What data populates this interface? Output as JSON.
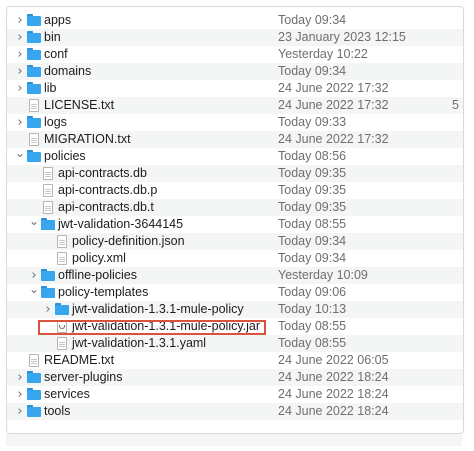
{
  "files": [
    {
      "name": "apps",
      "date": "Today 09:34",
      "type": "folder",
      "level": 0,
      "chevron": "right"
    },
    {
      "name": "bin",
      "date": "23 January 2023 12:15",
      "type": "folder",
      "level": 0,
      "chevron": "right"
    },
    {
      "name": "conf",
      "date": "Yesterday 10:22",
      "type": "folder",
      "level": 0,
      "chevron": "right"
    },
    {
      "name": "domains",
      "date": "Today 09:34",
      "type": "folder",
      "level": 0,
      "chevron": "right"
    },
    {
      "name": "lib",
      "date": "24 June 2022 17:32",
      "type": "folder",
      "level": 0,
      "chevron": "right"
    },
    {
      "name": "LICENSE.txt",
      "date": "24 June 2022 17:32",
      "type": "document",
      "level": 0,
      "chevron": "none",
      "extra": "5"
    },
    {
      "name": "logs",
      "date": "Today 09:33",
      "type": "folder",
      "level": 0,
      "chevron": "right"
    },
    {
      "name": "MIGRATION.txt",
      "date": "24 June 2022 17:32",
      "type": "document",
      "level": 0,
      "chevron": "none"
    },
    {
      "name": "policies",
      "date": "Today 08:56",
      "type": "folder",
      "level": 0,
      "chevron": "down"
    },
    {
      "name": "api-contracts.db",
      "date": "Today 09:35",
      "type": "document",
      "level": 1,
      "chevron": "none"
    },
    {
      "name": "api-contracts.db.p",
      "date": "Today 09:35",
      "type": "document",
      "level": 1,
      "chevron": "none"
    },
    {
      "name": "api-contracts.db.t",
      "date": "Today 09:35",
      "type": "document",
      "level": 1,
      "chevron": "none"
    },
    {
      "name": "jwt-validation-3644145",
      "date": "Today 08:55",
      "type": "folder",
      "level": 1,
      "chevron": "down"
    },
    {
      "name": "policy-definition.json",
      "date": "Today 09:34",
      "type": "document",
      "level": 2,
      "chevron": "none"
    },
    {
      "name": "policy.xml",
      "date": "Today 09:34",
      "type": "document",
      "level": 2,
      "chevron": "none"
    },
    {
      "name": "offline-policies",
      "date": "Yesterday 10:09",
      "type": "folder",
      "level": 1,
      "chevron": "right"
    },
    {
      "name": "policy-templates",
      "date": "Today 09:06",
      "type": "folder",
      "level": 1,
      "chevron": "down"
    },
    {
      "name": "jwt-validation-1.3.1-mule-policy",
      "date": "Today 10:13",
      "type": "folder",
      "level": 2,
      "chevron": "right"
    },
    {
      "name": "jwt-validation-1.3.1-mule-policy.jar",
      "date": "Today 08:55",
      "type": "jar",
      "level": 2,
      "chevron": "none",
      "highlighted": true
    },
    {
      "name": "jwt-validation-1.3.1.yaml",
      "date": "Today 08:55",
      "type": "document",
      "level": 2,
      "chevron": "none"
    },
    {
      "name": "README.txt",
      "date": "24 June 2022 06:05",
      "type": "document",
      "level": 0,
      "chevron": "none"
    },
    {
      "name": "server-plugins",
      "date": "24 June 2022 18:24",
      "type": "folder",
      "level": 0,
      "chevron": "right"
    },
    {
      "name": "services",
      "date": "24 June 2022 18:24",
      "type": "folder",
      "level": 0,
      "chevron": "right"
    },
    {
      "name": "tools",
      "date": "24 June 2022 18:24",
      "type": "folder",
      "level": 0,
      "chevron": "right"
    }
  ],
  "colors": {
    "folder": "#38a6ee",
    "highlight": "#d9533c",
    "stripe": "#f4f5f5"
  }
}
